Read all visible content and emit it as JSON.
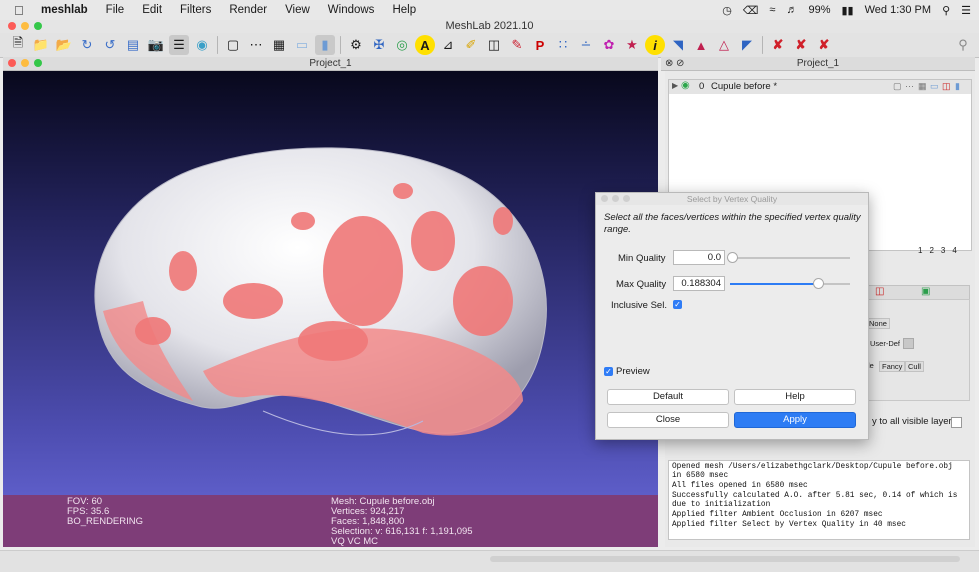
{
  "menubar": {
    "app_name": "meshlab",
    "items": [
      "File",
      "Edit",
      "Filters",
      "Render",
      "View",
      "Windows",
      "Help"
    ],
    "battery": "99%",
    "clock": "Wed 1:30 PM"
  },
  "window": {
    "title": "MeshLab 2021.10"
  },
  "project": {
    "title": "Project_1",
    "panel_title": "Project_1"
  },
  "layers": {
    "index": "0",
    "name": "Cupule before *",
    "page_numbers": [
      "1",
      "2",
      "3",
      "4"
    ]
  },
  "render_panel": {
    "labels": [
      "None",
      "User-Def",
      "le",
      "Fancy",
      "Cull"
    ],
    "apply_all_label": "y to all visible layers"
  },
  "viewport_info": {
    "fov": "FOV: 60",
    "fps": "FPS:   35.6",
    "rendering": "BO_RENDERING",
    "mesh": "Mesh: Cupule before.obj",
    "vertices": "Vertices: 924,217",
    "faces": "Faces: 1,848,800",
    "selection": "Selection: v: 616,131 f: 1,191,095",
    "attrs": "VQ VC MC"
  },
  "dialog": {
    "title": "Select by Vertex Quality",
    "description": "Select all the faces/vertices within the specified vertex quality range.",
    "min_label": "Min Quality",
    "min_value": "0.0",
    "min_slider_fraction": 0.02,
    "max_label": "Max Quality",
    "max_value": "0.188304",
    "max_slider_fraction": 0.73,
    "inclusive_label": "Inclusive Sel.",
    "preview_label": "Preview",
    "default_label": "Default",
    "help_label": "Help",
    "close_label": "Close",
    "apply_label": "Apply"
  },
  "log": {
    "lines": [
      "Opened mesh /Users/elizabethgclark/Desktop/Cupule before.obj in 6580 msec",
      "All files opened in 6580 msec",
      "Successfully calculated A.O. after 5.81 sec, 0.14 of which is due to initialization",
      "Applied filter Ambient Occlusion in 6207 msec",
      "Applied filter Select by Vertex Quality in 40 msec"
    ]
  },
  "colors": {
    "accent": "#2d7cf4",
    "info_bar": "#7e3d78",
    "selection": "#f08080"
  }
}
